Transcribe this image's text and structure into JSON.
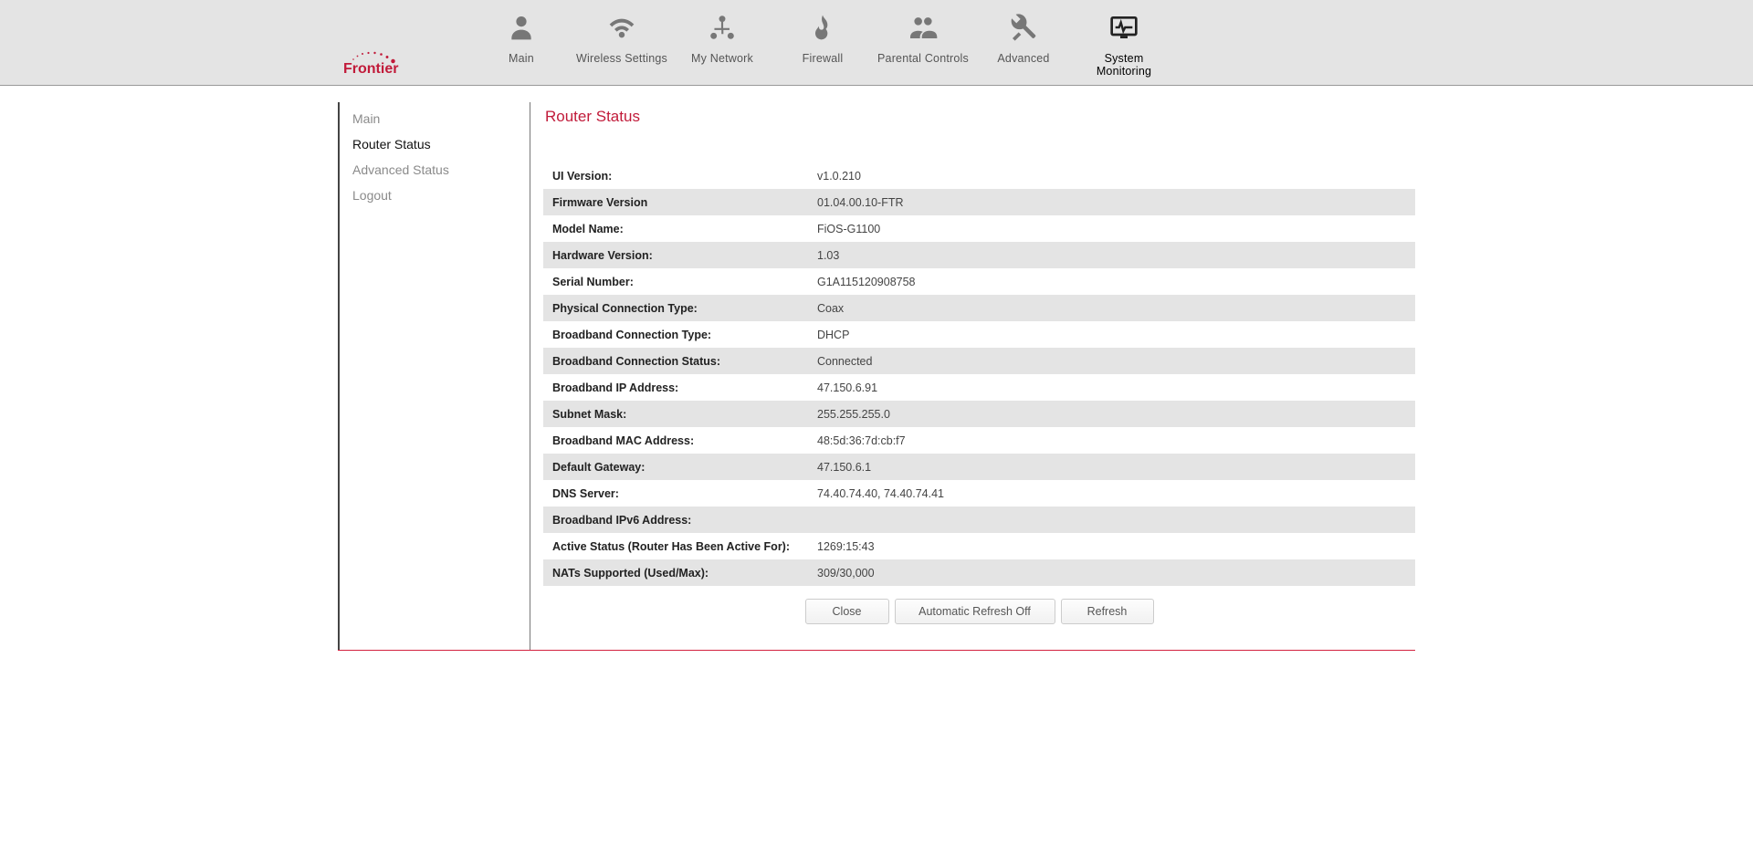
{
  "brand": "Frontier",
  "nav": {
    "items": [
      {
        "label": "Main"
      },
      {
        "label": "Wireless Settings"
      },
      {
        "label": "My Network"
      },
      {
        "label": "Firewall"
      },
      {
        "label": "Parental Controls"
      },
      {
        "label": "Advanced"
      },
      {
        "label": "System Monitoring"
      }
    ]
  },
  "sidebar": {
    "items": [
      {
        "label": "Main"
      },
      {
        "label": "Router Status"
      },
      {
        "label": "Advanced Status"
      },
      {
        "label": "Logout"
      }
    ]
  },
  "page_title": "Router Status",
  "status_rows": [
    {
      "label": "UI Version:",
      "value": "v1.0.210"
    },
    {
      "label": "Firmware Version",
      "value": "01.04.00.10-FTR"
    },
    {
      "label": "Model Name:",
      "value": "FiOS-G1100"
    },
    {
      "label": "Hardware Version:",
      "value": "1.03"
    },
    {
      "label": "Serial Number:",
      "value": "G1A115120908758"
    },
    {
      "label": "Physical Connection Type:",
      "value": "Coax"
    },
    {
      "label": "Broadband Connection Type:",
      "value": "DHCP"
    },
    {
      "label": "Broadband Connection Status:",
      "value": "Connected",
      "status": true
    },
    {
      "label": "Broadband IP Address:",
      "value": "47.150.6.91"
    },
    {
      "label": "Subnet Mask:",
      "value": "255.255.255.0"
    },
    {
      "label": "Broadband MAC Address:",
      "value": "48:5d:36:7d:cb:f7"
    },
    {
      "label": "Default Gateway:",
      "value": "47.150.6.1"
    },
    {
      "label": "DNS Server:",
      "value": "74.40.74.40, 74.40.74.41"
    },
    {
      "label": "Broadband IPv6 Address:",
      "value": ""
    },
    {
      "label": "Active Status (Router Has Been Active For):",
      "value": "1269:15:43"
    },
    {
      "label": "NATs Supported (Used/Max):",
      "value": "309/30,000"
    }
  ],
  "buttons": {
    "close": "Close",
    "auto_refresh": "Automatic Refresh Off",
    "refresh": "Refresh"
  }
}
